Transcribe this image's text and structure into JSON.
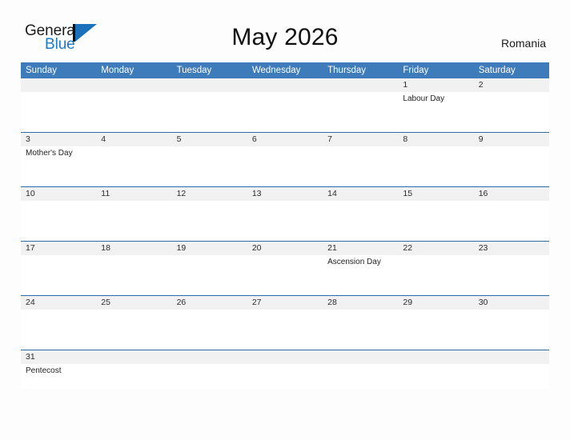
{
  "brand": {
    "word_one": "General",
    "word_two": "Blue",
    "accent_color": "#1b72bb"
  },
  "header": {
    "title": "May 2026",
    "country": "Romania",
    "header_bg_color": "#3d7bba",
    "row_divider_color": "#2e6da4",
    "date_band_color": "#f1f1f1"
  },
  "weekdays": [
    "Sunday",
    "Monday",
    "Tuesday",
    "Wednesday",
    "Thursday",
    "Friday",
    "Saturday"
  ],
  "weeks": [
    {
      "days": [
        {
          "date": "",
          "event": ""
        },
        {
          "date": "",
          "event": ""
        },
        {
          "date": "",
          "event": ""
        },
        {
          "date": "",
          "event": ""
        },
        {
          "date": "",
          "event": ""
        },
        {
          "date": "1",
          "event": "Labour Day"
        },
        {
          "date": "2",
          "event": ""
        }
      ]
    },
    {
      "days": [
        {
          "date": "3",
          "event": "Mother's Day"
        },
        {
          "date": "4",
          "event": ""
        },
        {
          "date": "5",
          "event": ""
        },
        {
          "date": "6",
          "event": ""
        },
        {
          "date": "7",
          "event": ""
        },
        {
          "date": "8",
          "event": ""
        },
        {
          "date": "9",
          "event": ""
        }
      ]
    },
    {
      "days": [
        {
          "date": "10",
          "event": ""
        },
        {
          "date": "11",
          "event": ""
        },
        {
          "date": "12",
          "event": ""
        },
        {
          "date": "13",
          "event": ""
        },
        {
          "date": "14",
          "event": ""
        },
        {
          "date": "15",
          "event": ""
        },
        {
          "date": "16",
          "event": ""
        }
      ]
    },
    {
      "days": [
        {
          "date": "17",
          "event": ""
        },
        {
          "date": "18",
          "event": ""
        },
        {
          "date": "19",
          "event": ""
        },
        {
          "date": "20",
          "event": ""
        },
        {
          "date": "21",
          "event": "Ascension Day"
        },
        {
          "date": "22",
          "event": ""
        },
        {
          "date": "23",
          "event": ""
        }
      ]
    },
    {
      "days": [
        {
          "date": "24",
          "event": ""
        },
        {
          "date": "25",
          "event": ""
        },
        {
          "date": "26",
          "event": ""
        },
        {
          "date": "27",
          "event": ""
        },
        {
          "date": "28",
          "event": ""
        },
        {
          "date": "29",
          "event": ""
        },
        {
          "date": "30",
          "event": ""
        }
      ]
    },
    {
      "days": [
        {
          "date": "31",
          "event": "Pentecost"
        },
        {
          "date": "",
          "event": ""
        },
        {
          "date": "",
          "event": ""
        },
        {
          "date": "",
          "event": ""
        },
        {
          "date": "",
          "event": ""
        },
        {
          "date": "",
          "event": ""
        },
        {
          "date": "",
          "event": ""
        }
      ]
    }
  ]
}
